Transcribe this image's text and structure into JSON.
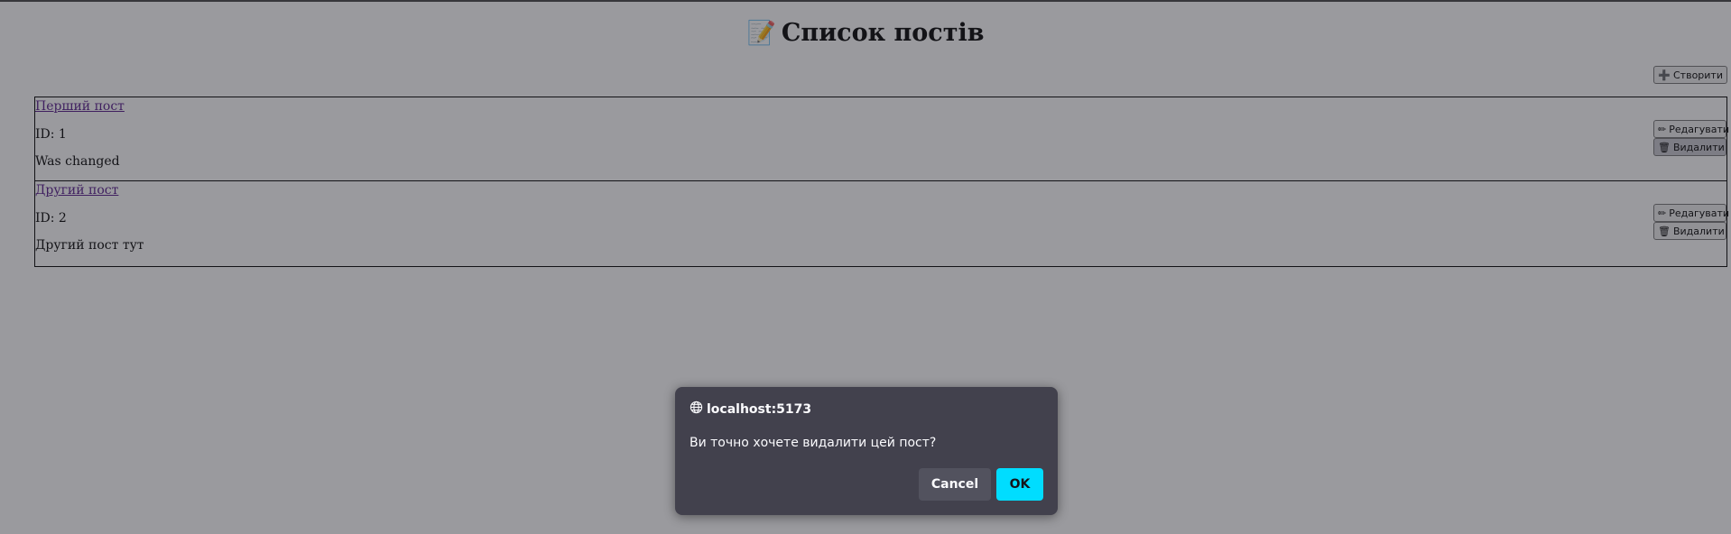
{
  "page": {
    "heading_icon": "📝",
    "heading": "Список постів",
    "create_icon": "➕",
    "create_label": "Створити"
  },
  "posts": [
    {
      "title": "Перший пост",
      "id_label": "ID: 1",
      "body": "Was changed",
      "edit_icon": "✏",
      "edit_label": "Редагувати",
      "delete_icon": "🗑",
      "delete_label": "Видалити"
    },
    {
      "title": "Другий пост",
      "id_label": "ID: 2",
      "body": "Другий пост тут",
      "edit_icon": "✏",
      "edit_label": "Редагувати",
      "delete_icon": "🗑",
      "delete_label": "Видалити"
    }
  ],
  "dialog": {
    "origin": "localhost:5173",
    "message": "Ви точно хочете видалити цей пост?",
    "cancel_label": "Cancel",
    "ok_label": "OK"
  },
  "colors": {
    "overlay": "#28283078",
    "dialog_bg": "#42414d",
    "ok_button": "#00ddff",
    "link": "#551a8b"
  }
}
